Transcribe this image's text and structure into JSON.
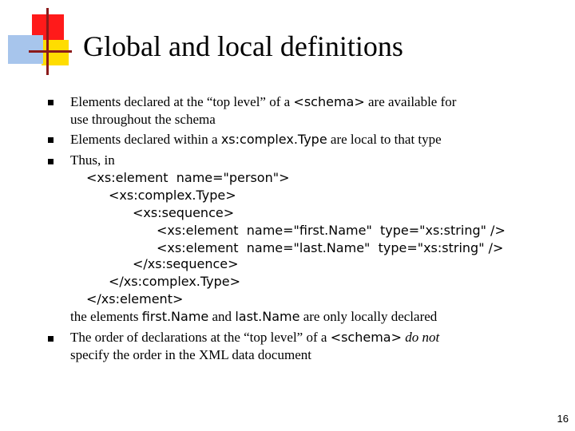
{
  "slide": {
    "title": "Global and local definitions",
    "page_number": "16",
    "colors": {
      "logo_red": "#ff1a1a",
      "logo_yellow": "#ffdd00",
      "logo_blue": "#a7c5ec",
      "logo_line": "#8b1a1a"
    }
  },
  "bullets": {
    "b1": {
      "pre": "Elements declared at the “top level” of a ",
      "code": "<schema>",
      "post": " are available for",
      "cont": "use throughout the schema"
    },
    "b2": {
      "pre": "Elements declared within a ",
      "code": "xs:complex.Type",
      "post": " are local to that type"
    },
    "b3": {
      "lead": "Thus, in",
      "code_lines": [
        "<xs:element  name=\"person\">",
        "<xs:complex.Type>",
        "<xs:sequence>",
        "<xs:element  name=\"first.Name\"  type=\"xs:string\" />",
        "<xs:element  name=\"last.Name\"  type=\"xs:string\" />",
        "</xs:sequence>",
        "</xs:complex.Type>",
        "</xs:element>"
      ],
      "tail_pre": "the elements ",
      "tail_code1": "first.Name",
      "tail_mid": " and ",
      "tail_code2": "last.Name",
      "tail_post": " are only locally declared"
    },
    "b4": {
      "pre": "The order of declarations at the “top level” of a ",
      "code": "<schema>",
      "emph": "do not",
      "cont": "specify the order in the XML data document"
    }
  }
}
